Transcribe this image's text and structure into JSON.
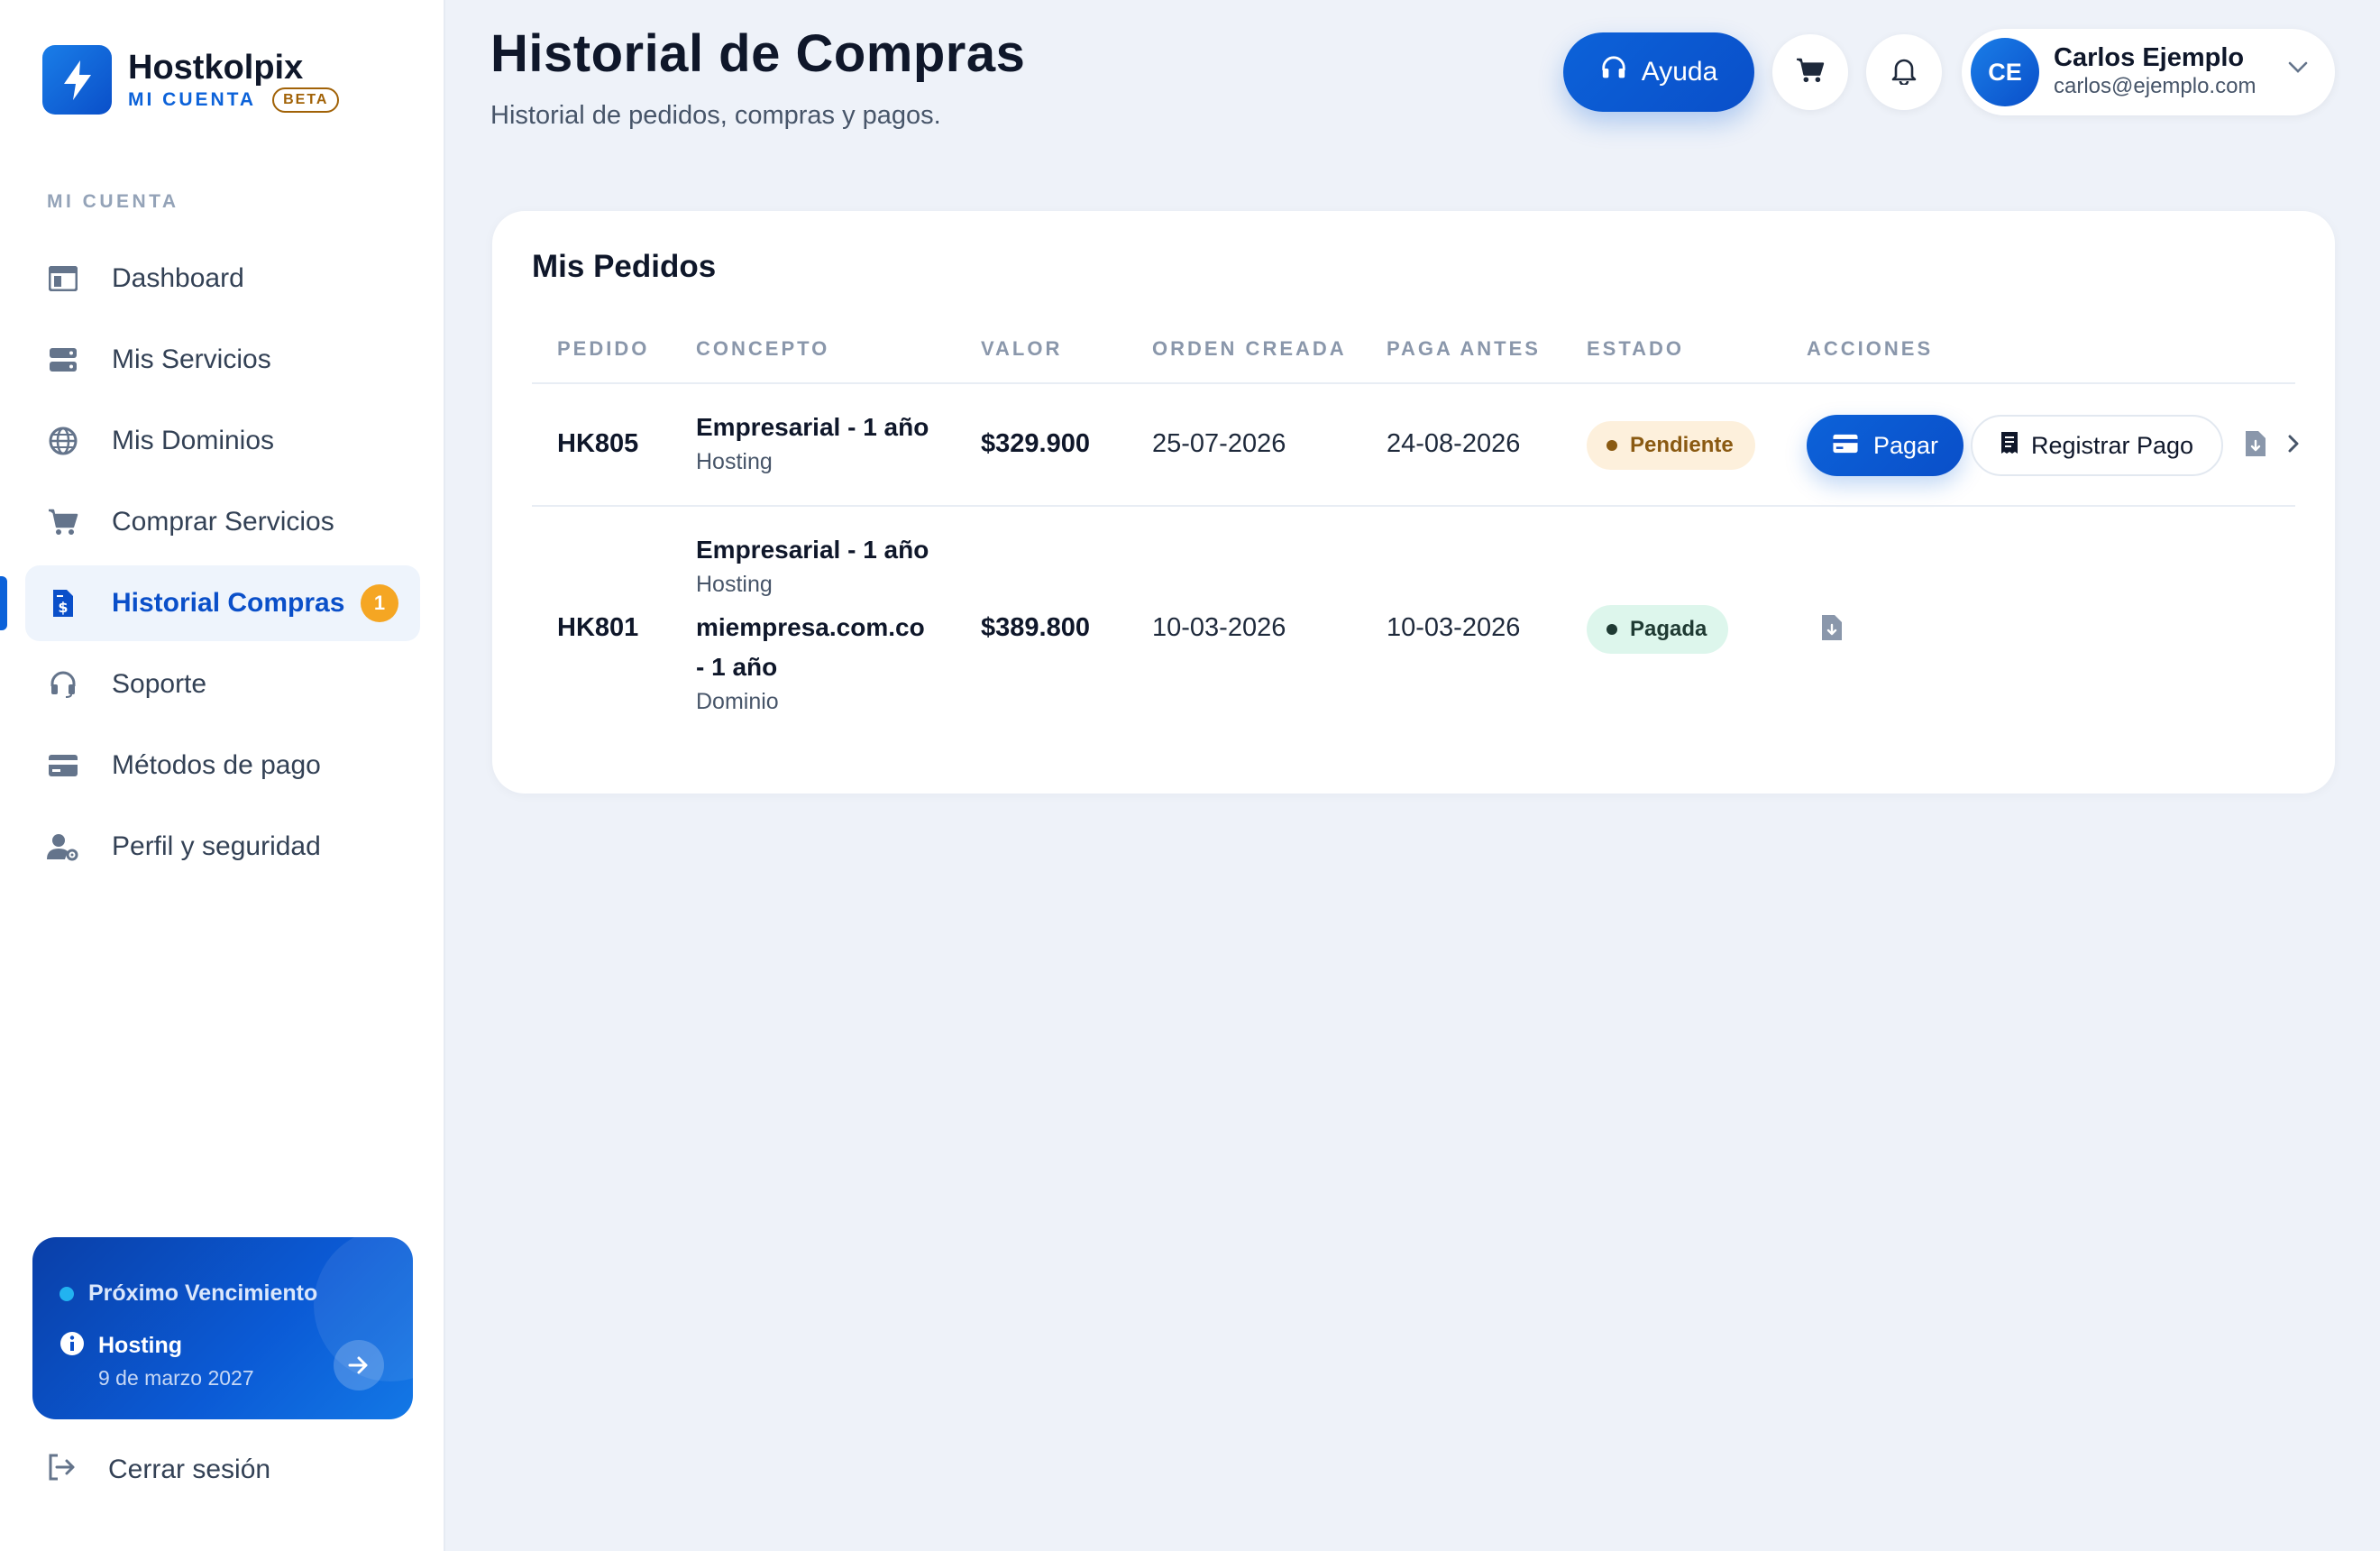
{
  "brand": {
    "name": "Hostkolpix",
    "subtitle": "MI CUENTA",
    "badge": "BETA"
  },
  "sidebar": {
    "section_label": "MI CUENTA",
    "items": [
      {
        "label": "Dashboard",
        "icon": "dashboard-icon"
      },
      {
        "label": "Mis Servicios",
        "icon": "server-icon"
      },
      {
        "label": "Mis Dominios",
        "icon": "globe-icon"
      },
      {
        "label": "Comprar Servicios",
        "icon": "cart-icon"
      },
      {
        "label": "Historial Compras",
        "icon": "invoice-dollar-icon",
        "active": true,
        "count": "1"
      },
      {
        "label": "Soporte",
        "icon": "headset-icon"
      },
      {
        "label": "Métodos de pago",
        "icon": "credit-card-icon"
      },
      {
        "label": "Perfil y seguridad",
        "icon": "user-gear-icon"
      }
    ],
    "due_card": {
      "title": "Próximo Vencimiento",
      "service": "Hosting",
      "date": "9 de marzo 2027"
    },
    "logout_label": "Cerrar sesión"
  },
  "header": {
    "title": "Historial de Compras",
    "subtitle": "Historial de pedidos, compras y pagos.",
    "help_label": "Ayuda",
    "user": {
      "initials": "CE",
      "name": "Carlos Ejemplo",
      "email": "carlos@ejemplo.com"
    }
  },
  "orders": {
    "title": "Mis Pedidos",
    "columns": [
      "PEDIDO",
      "CONCEPTO",
      "VALOR",
      "ORDEN CREADA",
      "PAGA ANTES",
      "ESTADO",
      "ACCIONES"
    ],
    "rows": [
      {
        "id": "HK805",
        "concepts": [
          {
            "title": "Empresarial - 1 año",
            "type": "Hosting"
          }
        ],
        "amount": "$329.900",
        "created": "25-07-2026",
        "due": "24-08-2026",
        "status": "Pendiente",
        "actions": {
          "pay": "Pagar",
          "register": "Registrar Pago"
        }
      },
      {
        "id": "HK801",
        "concepts": [
          {
            "title": "Empresarial - 1 año",
            "type": "Hosting"
          },
          {
            "title_line1": "miempresa.com.co",
            "title_line2": "- 1 año",
            "type": "Dominio"
          }
        ],
        "amount": "$389.800",
        "created": "10-03-2026",
        "due": "10-03-2026",
        "status": "Pagada"
      }
    ]
  },
  "colors": {
    "accent": "#0c62d9",
    "pending_bg": "#fdf0dc",
    "paid_bg": "#ddf6ec",
    "badge_count": "#f5a623"
  }
}
